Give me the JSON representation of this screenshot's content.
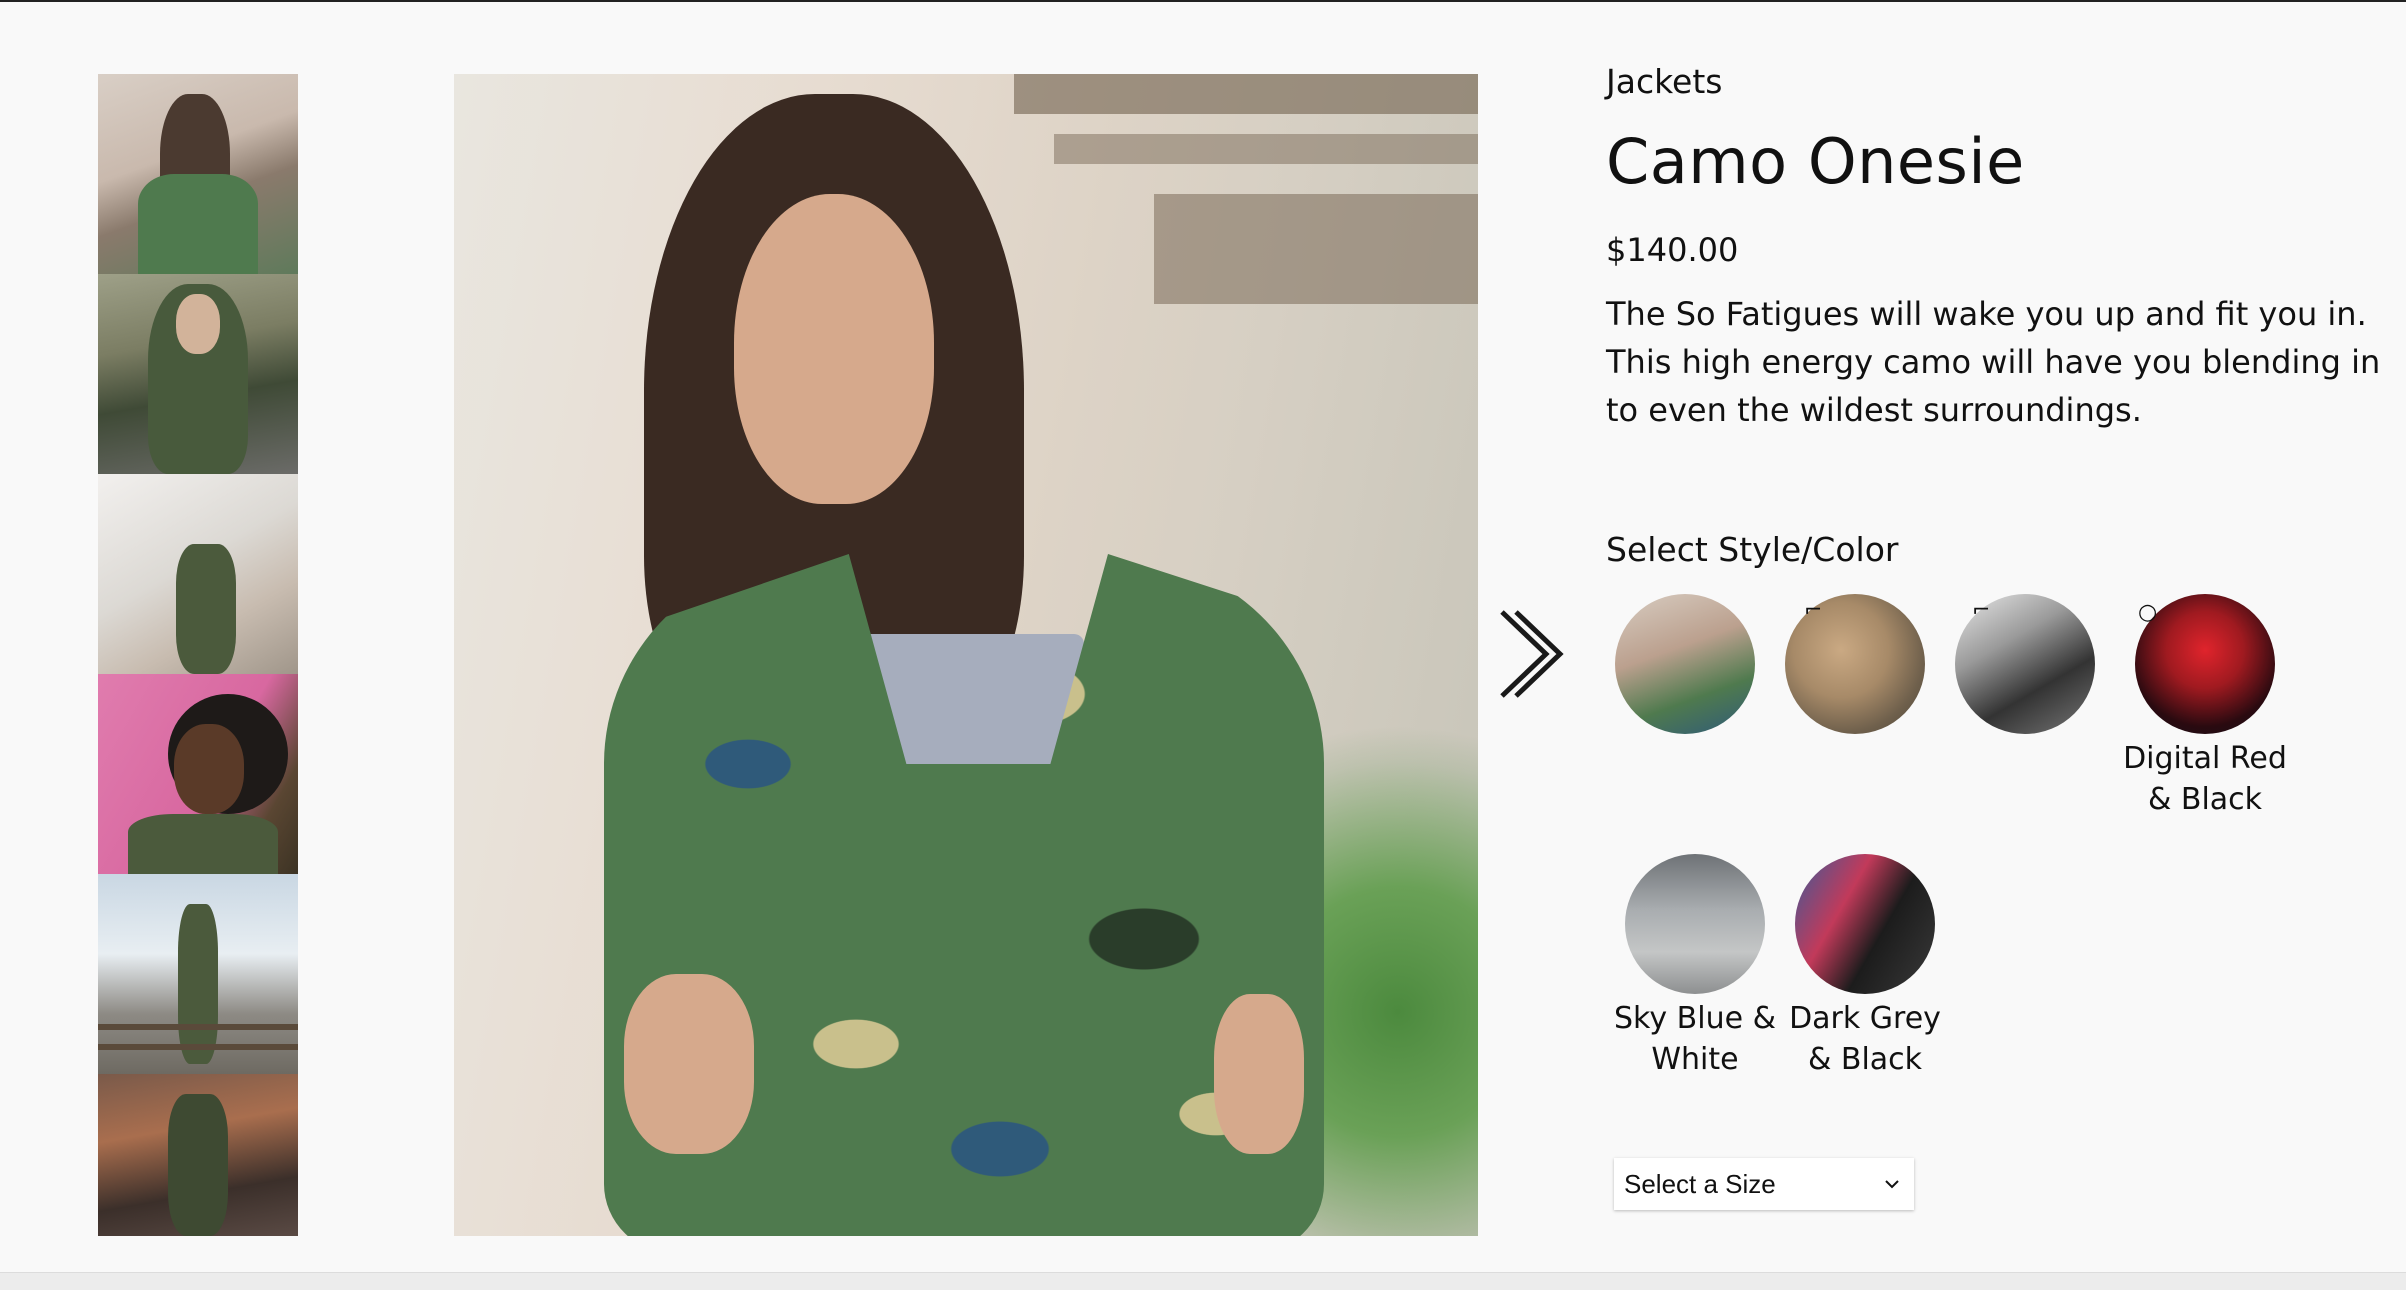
{
  "product": {
    "category": "Jackets",
    "name": "Camo Onesie",
    "price": "$140.00",
    "description": "The So Fatigues will wake you up and fit you in. This high energy camo will have you blending in to even the wildest surroundings."
  },
  "styles": {
    "heading": "Select Style/Color",
    "options": [
      {
        "label": "",
        "icon": "camo-green-swatch"
      },
      {
        "label": "",
        "icon": "desert-rock-swatch"
      },
      {
        "label": "",
        "icon": "urban-grey-swatch"
      },
      {
        "label": "Digital Red & Black",
        "icon": "digital-red-swatch"
      },
      {
        "label": "Sky Blue & White",
        "icon": "sky-blue-swatch"
      },
      {
        "label": "Dark Grey & Black",
        "icon": "dark-grey-swatch"
      }
    ]
  },
  "size": {
    "placeholder": "Select a Size"
  },
  "gallery": {
    "next_icon": "chevron-right-icon",
    "thumbnail_count": 6
  },
  "colors": {
    "background": "#f9f9f9",
    "text": "#111111"
  }
}
